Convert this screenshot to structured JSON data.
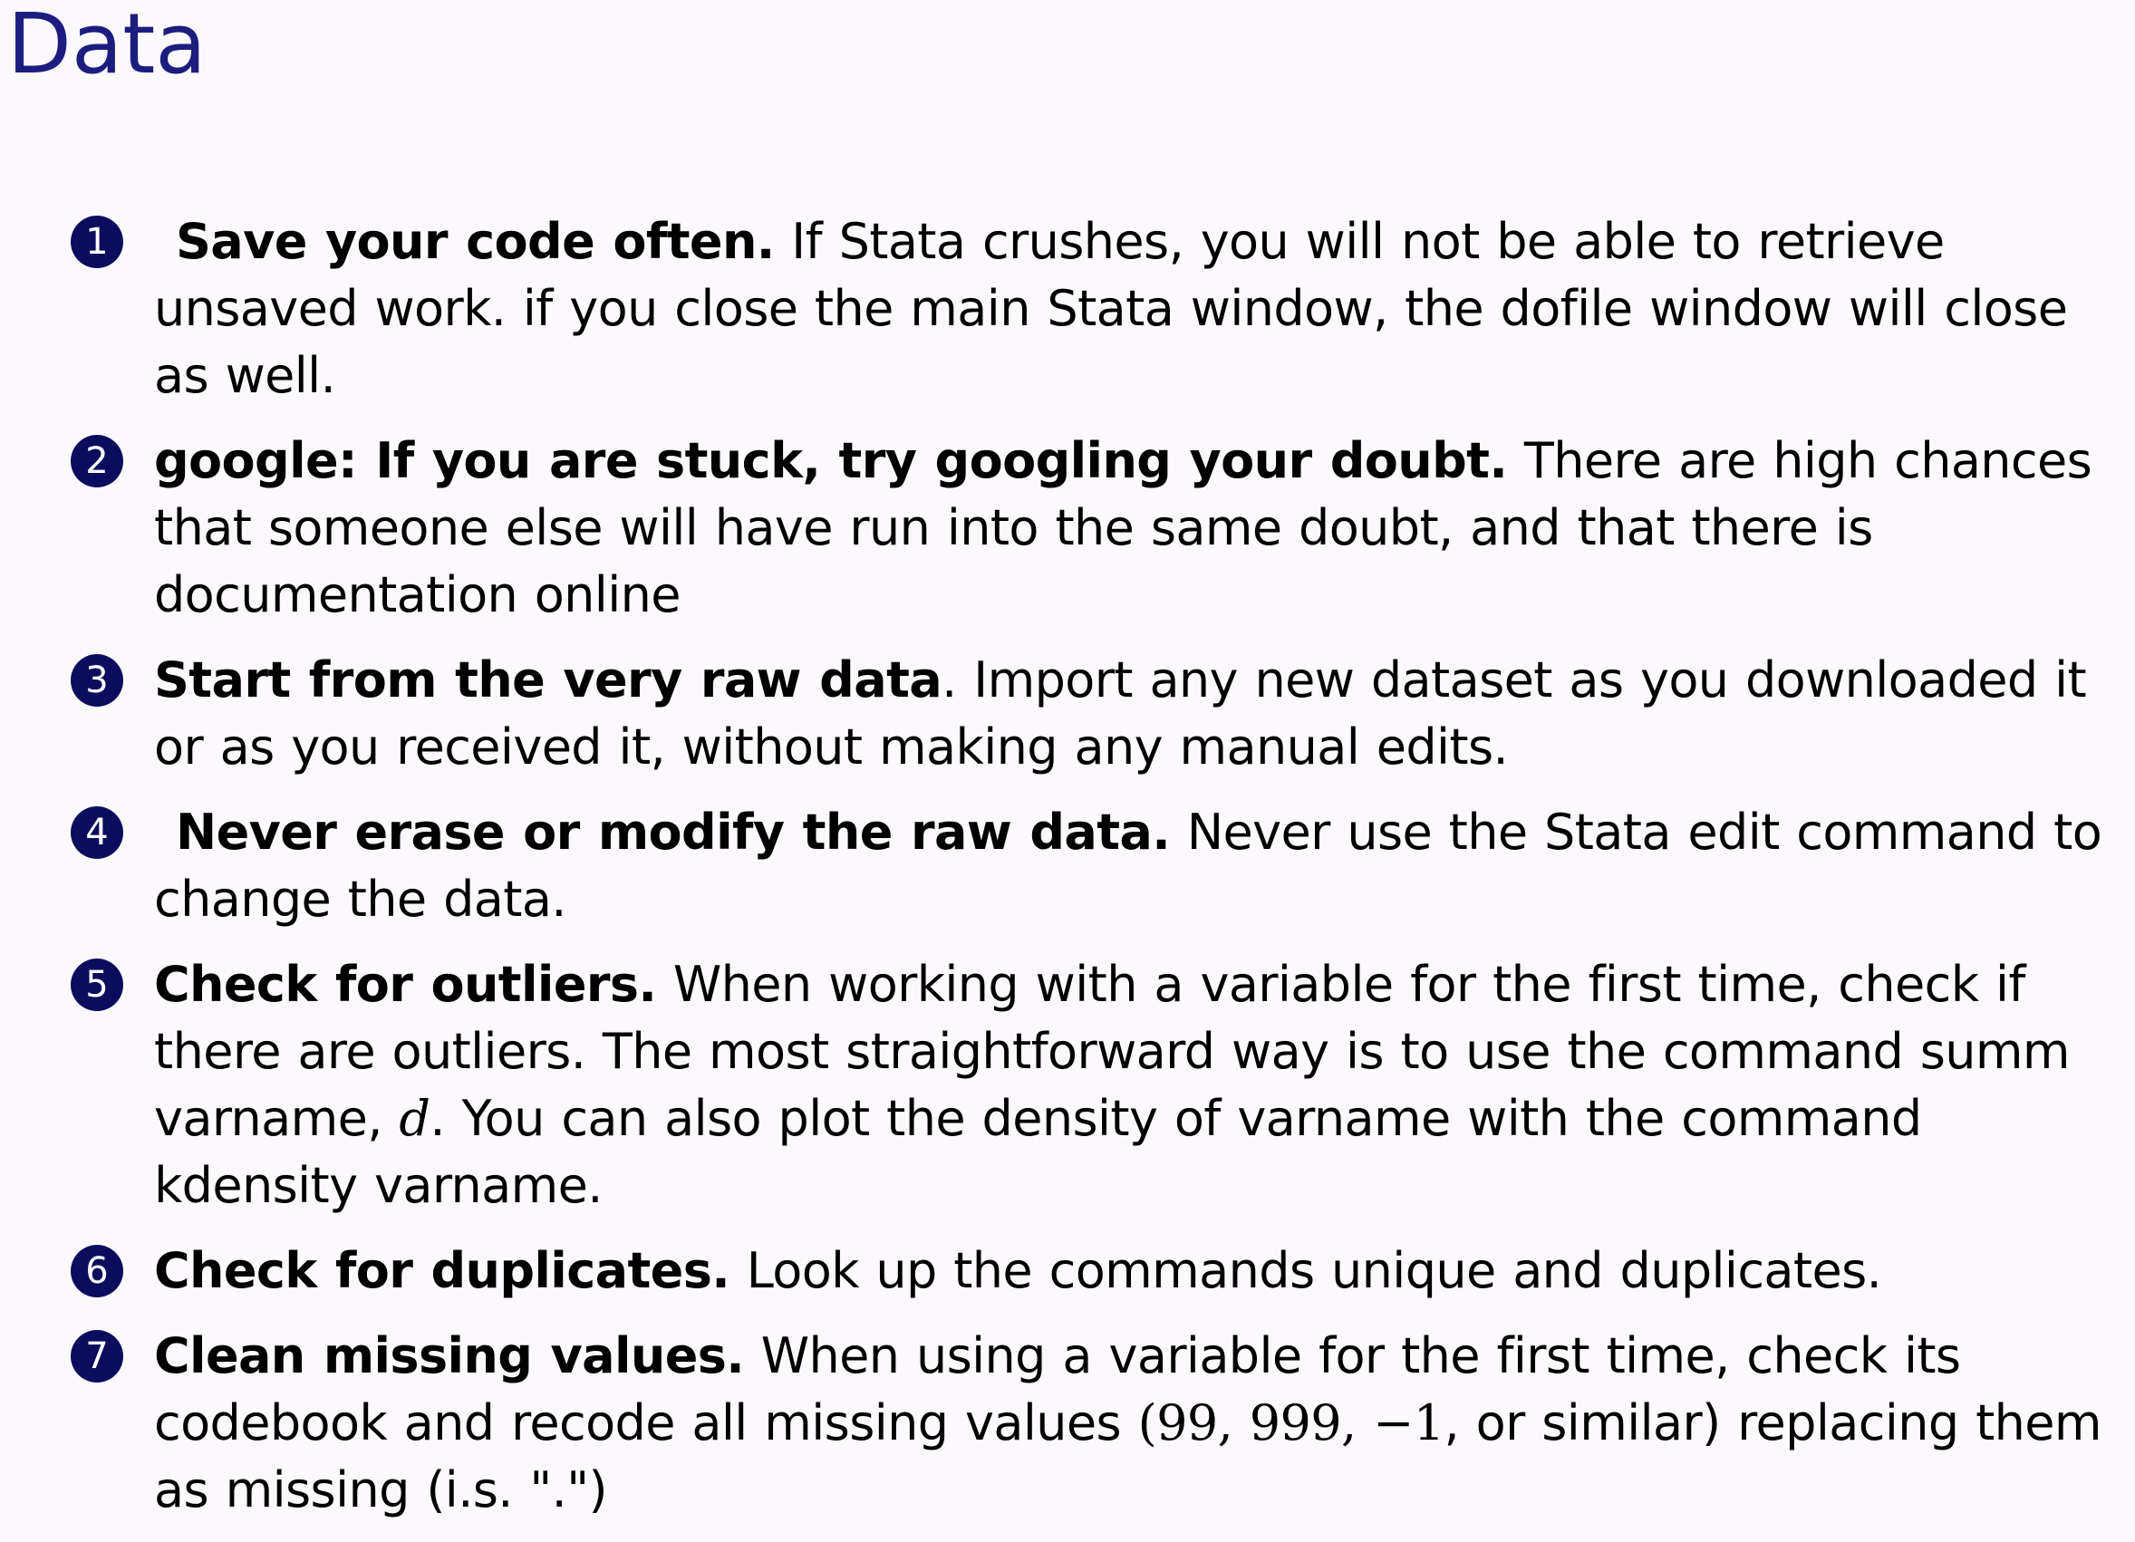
{
  "title": "Data",
  "items": [
    {
      "num": "1",
      "lead": "Save your code often.",
      "text": " If Stata crushes, you will not be able to retrieve unsaved work. if you close the main Stata window, the dofile window will close as well."
    },
    {
      "num": "2",
      "lead": "google: If you are stuck, try googling your doubt.",
      "text": " There are high chances that someone else will have run into the same doubt, and that there is documentation online"
    },
    {
      "num": "3",
      "lead": "Start from the very raw data",
      "text": ". Import any new dataset as you downloaded it or as you received it, without making any manual edits."
    },
    {
      "num": "4",
      "lead": "Never erase or modify the raw data.",
      "text": " Never use the Stata edit command to change the data."
    },
    {
      "num": "5",
      "lead": "Check for outliers.",
      "text_a": " When working with a variable for the first time, check if there are outliers. The most straightforward way is to use the command summ varname, ",
      "math_var": "d",
      "text_b": ". You can also plot the density of varname with the command kdensity varname."
    },
    {
      "num": "6",
      "lead": "Check for duplicates.",
      "text": " Look up the commands unique and duplicates."
    },
    {
      "num": "7",
      "lead": "Clean missing values.",
      "text_a": " When using a variable for the first time, check its codebook and recode all missing values ",
      "math_expr": "(99, 999, −1",
      "text_b": ", or similar) replacing them as missing (i.s. \".\")"
    }
  ]
}
